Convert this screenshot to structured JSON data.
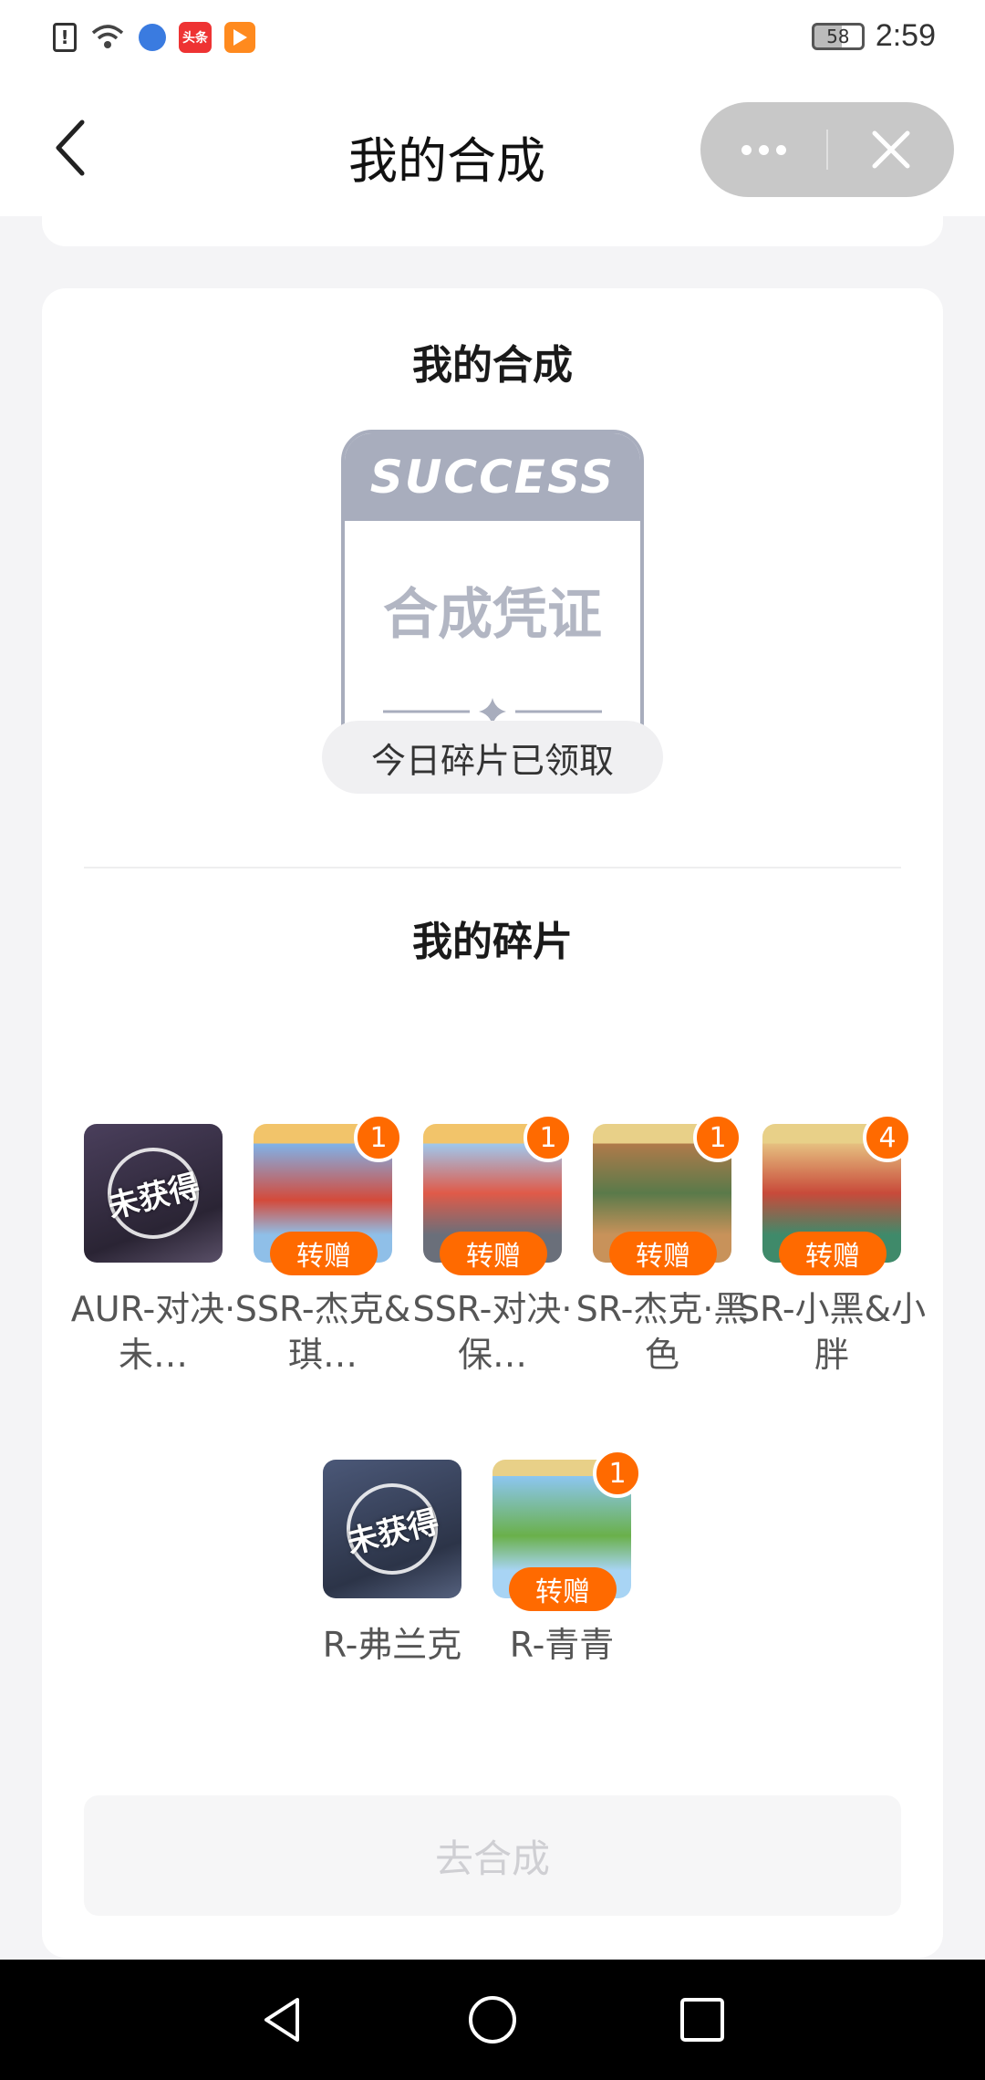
{
  "status_bar": {
    "battery": "58",
    "time": "2:59",
    "toutiao_label": "头条"
  },
  "nav": {
    "title": "我的合成"
  },
  "synthesis": {
    "title": "我的合成",
    "cert_header": "SUCCESS",
    "cert_body": "合成凭证"
  },
  "fragments": {
    "title": "我的碎片",
    "pill": "今日碎片已领取",
    "gift_label": "转赠",
    "unobtained_label": "未获得",
    "items": [
      {
        "name": "AUR-对决·未…",
        "count": null,
        "status": "unobtained",
        "rarity": "AUR",
        "color": "#3b3448"
      },
      {
        "name": "SSR-杰克&琪…",
        "count": "1",
        "status": "owned",
        "rarity": "SSR",
        "color": "#5a8fd8"
      },
      {
        "name": "SSR-对决·保…",
        "count": "1",
        "status": "owned",
        "rarity": "SSR",
        "color": "#6b9fe0"
      },
      {
        "name": "SR-杰克·黑色",
        "count": "1",
        "status": "owned",
        "rarity": "SR",
        "color": "#c98a4a"
      },
      {
        "name": "SR-小黑&小胖",
        "count": "4",
        "status": "owned",
        "rarity": "SR",
        "color": "#d6a060"
      },
      {
        "name": "R-弗兰克",
        "count": null,
        "status": "unobtained",
        "rarity": "R",
        "color": "#3d4a66"
      },
      {
        "name": "R-青青",
        "count": "1",
        "status": "owned",
        "rarity": "R",
        "color": "#4aa0e8"
      }
    ]
  },
  "action": {
    "synthesize_label": "去合成"
  },
  "colors": {
    "accent": "#ff6a00",
    "cert_gray": "#a8adbd"
  }
}
